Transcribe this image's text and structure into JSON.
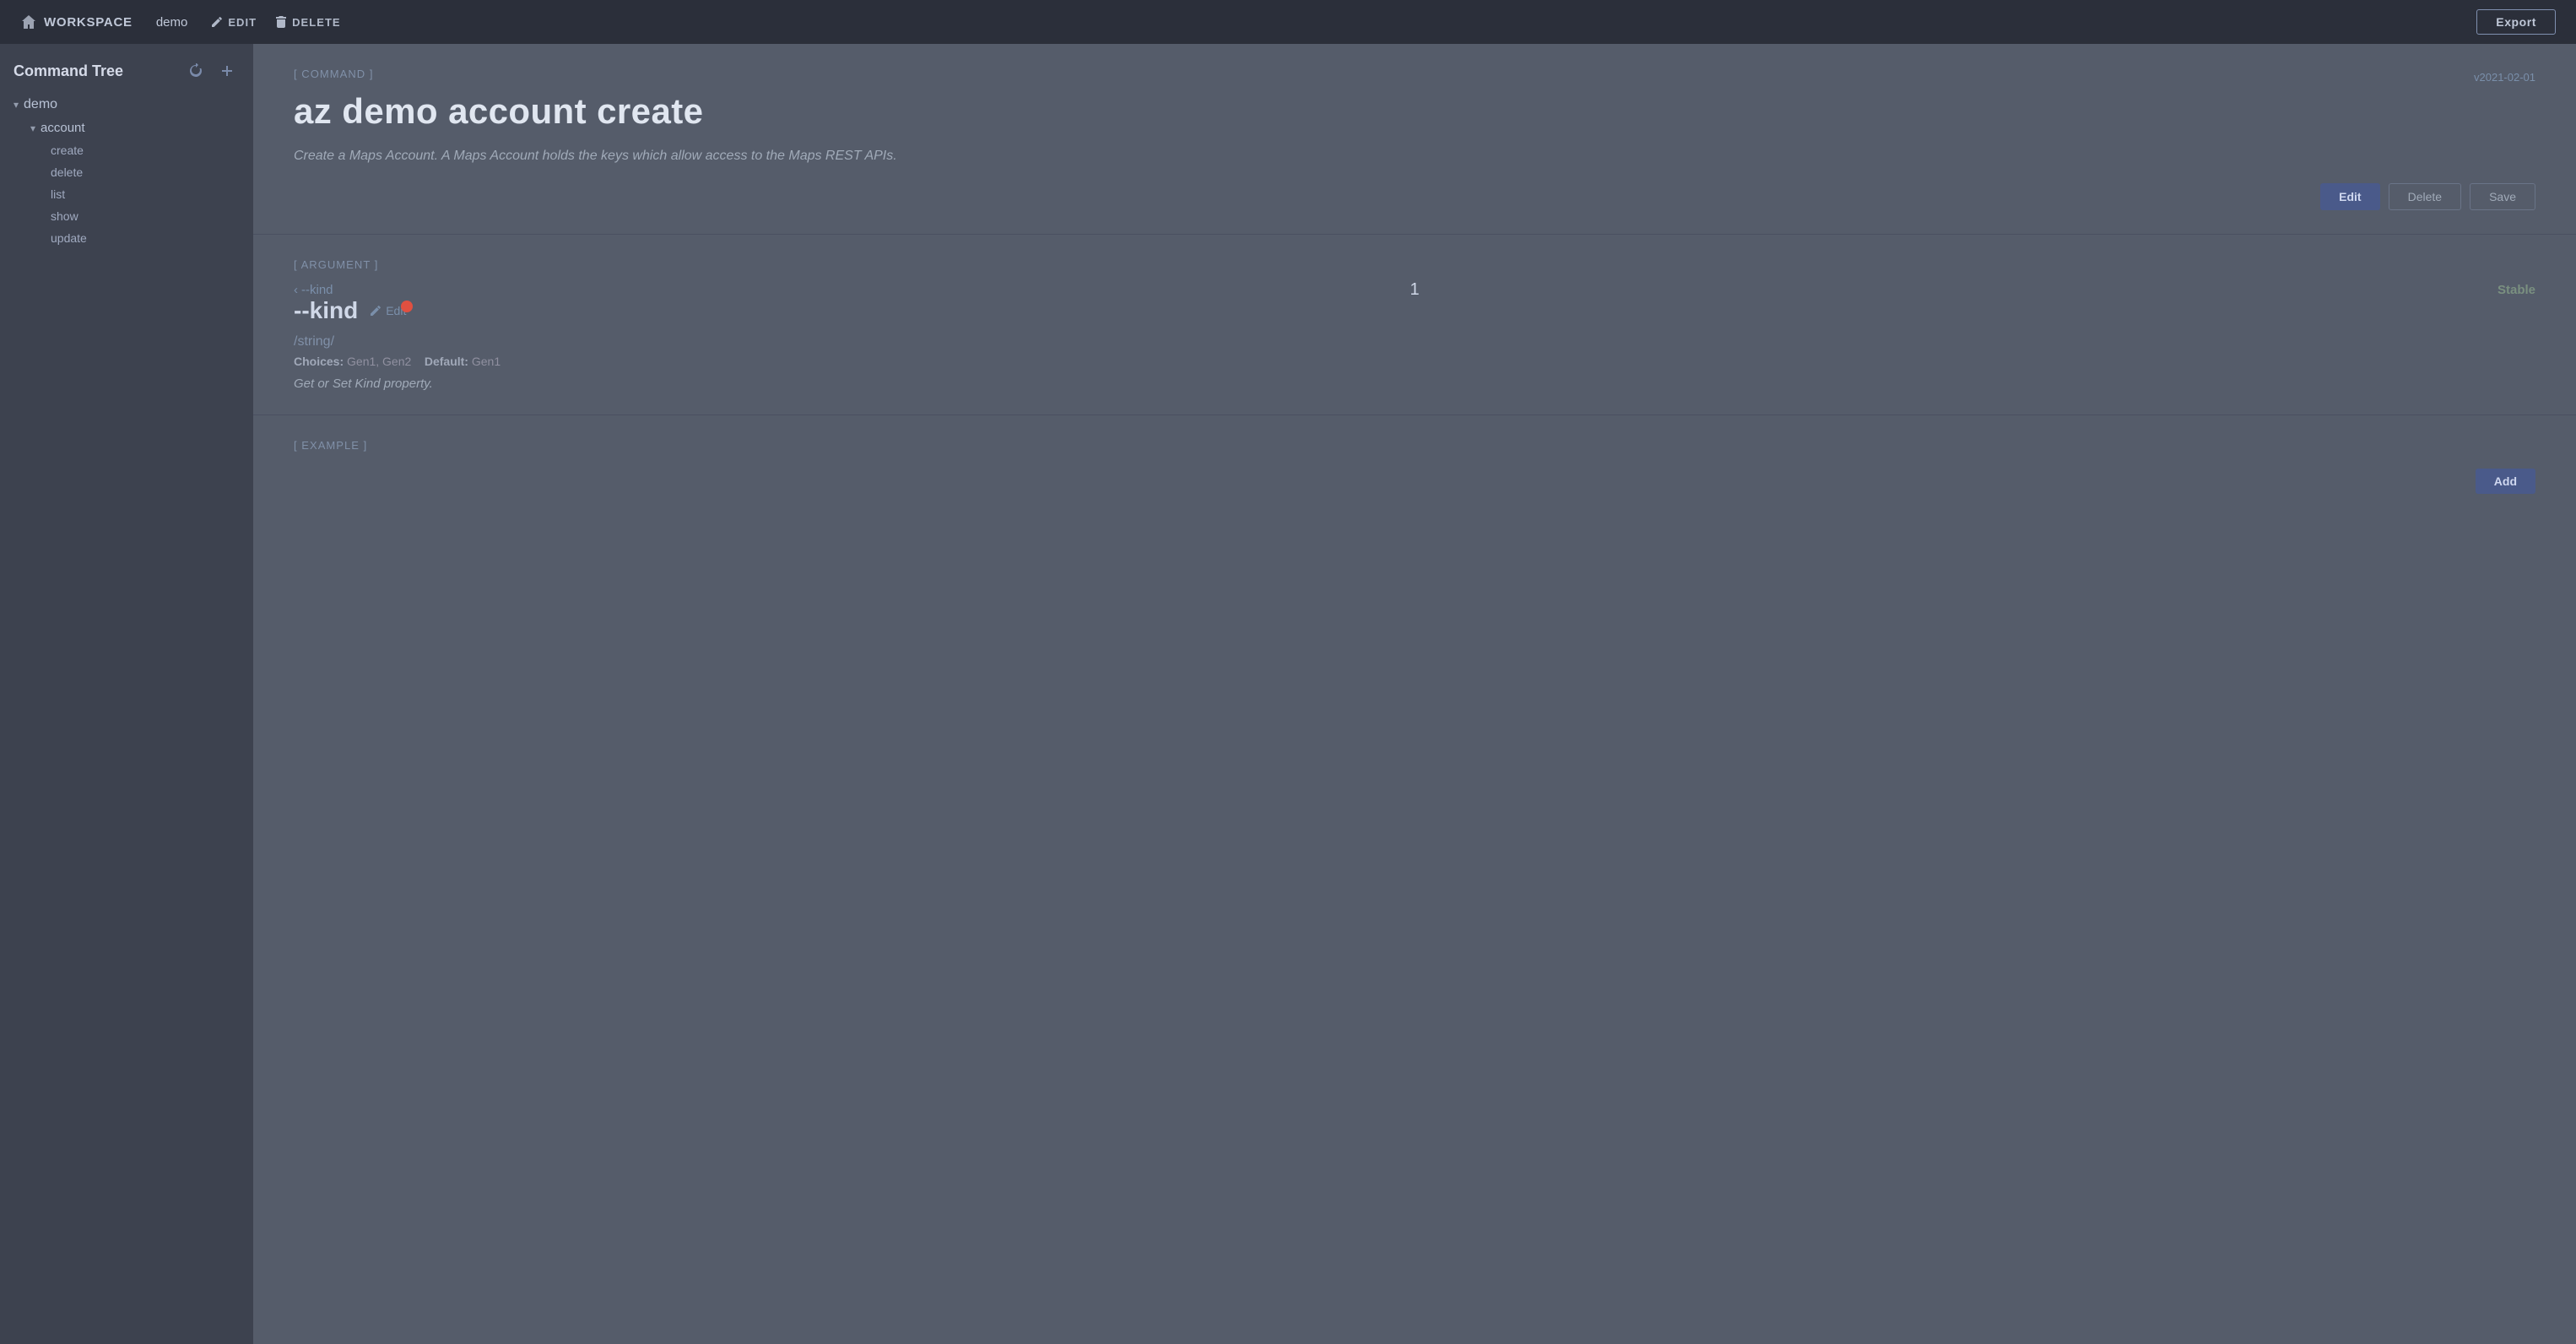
{
  "topnav": {
    "home_label": "WORKSPACE",
    "demo_label": "demo",
    "edit_label": "EDIT",
    "delete_label": "DELETE",
    "export_label": "Export"
  },
  "sidebar": {
    "title": "Command Tree",
    "tree": [
      {
        "label": "demo",
        "level": 0,
        "icon": "chevron-down",
        "expanded": true
      },
      {
        "label": "account",
        "level": 1,
        "icon": "chevron-down",
        "expanded": true
      },
      {
        "label": "create",
        "level": 2,
        "icon": ""
      },
      {
        "label": "delete",
        "level": 2,
        "icon": ""
      },
      {
        "label": "list",
        "level": 2,
        "icon": ""
      },
      {
        "label": "show",
        "level": 2,
        "icon": ""
      },
      {
        "label": "update",
        "level": 2,
        "icon": ""
      }
    ]
  },
  "command_section": {
    "section_label": "[ COMMAND ]",
    "command_title": "az demo account create",
    "version": "v2021-02-01",
    "description": "Create a Maps Account. A Maps Account holds the keys which allow access to the Maps REST APIs.",
    "edit_btn": "Edit",
    "delete_btn": "Delete",
    "save_btn": "Save"
  },
  "argument_section": {
    "section_label": "[ ARGUMENT ]",
    "nav_back_label": "--kind",
    "counter": "1",
    "status": "Stable",
    "arg_name": "--kind",
    "edit_label": "Edit",
    "arg_type": "/string/",
    "choices_label": "Choices:",
    "choices_value": "Gen1, Gen2",
    "default_label": "Default:",
    "default_value": "Gen1",
    "description": "Get or Set Kind property."
  },
  "example_section": {
    "section_label": "[ EXAMPLE ]",
    "add_btn": "Add"
  }
}
